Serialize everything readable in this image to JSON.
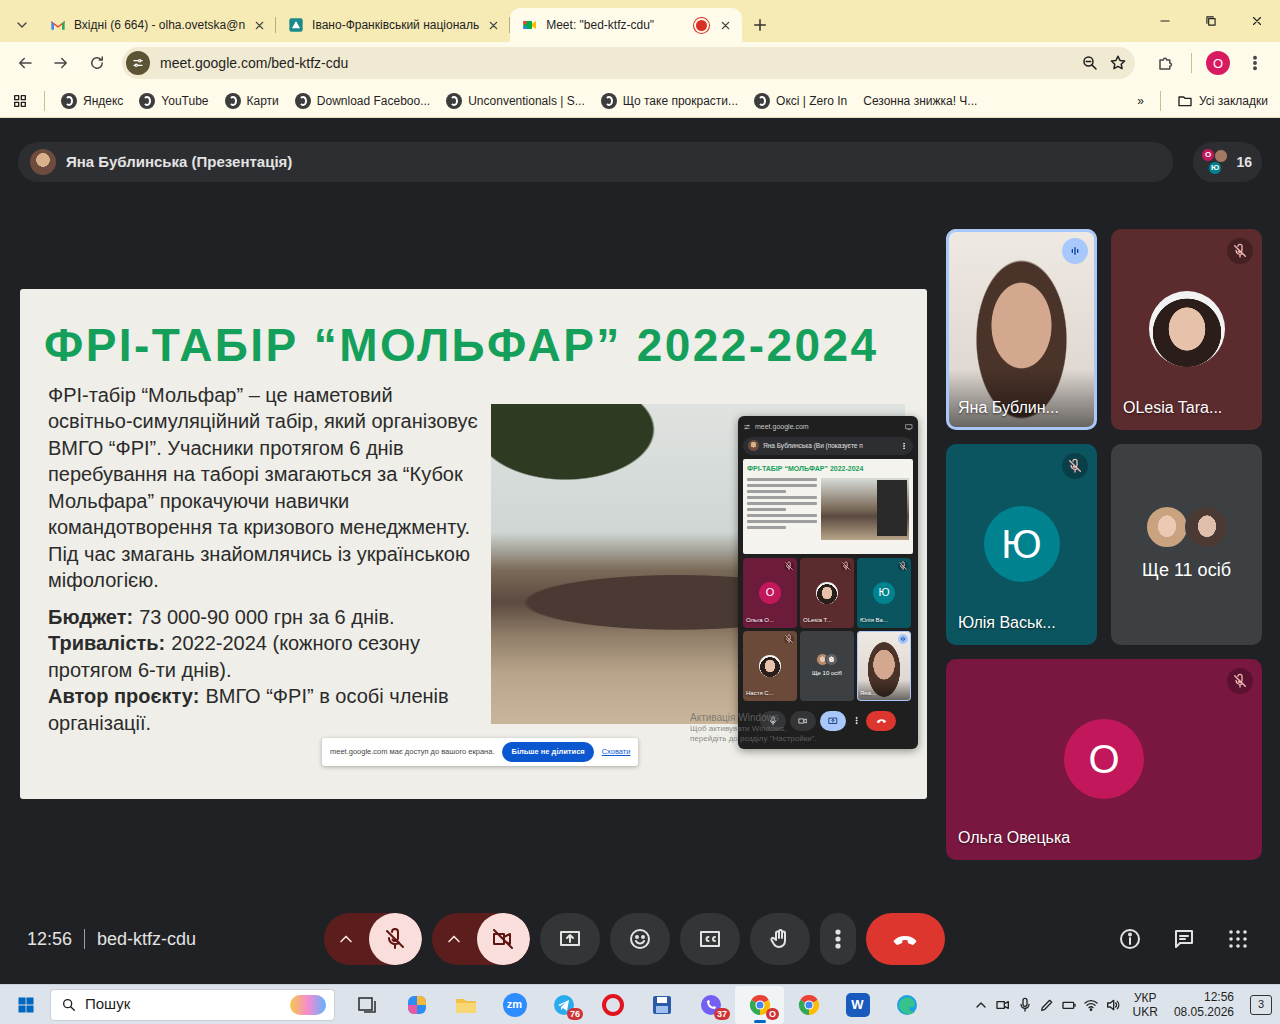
{
  "browser": {
    "tabs": [
      {
        "label": "Вхідні (6 664) - olha.ovetska@n",
        "kind": "gmail",
        "selected": false,
        "recording": false
      },
      {
        "label": "Івано-Франківський національ",
        "kind": "site",
        "selected": false,
        "recording": false
      },
      {
        "label": "Meet: \"bed-ktfz-cdu\"",
        "kind": "meet",
        "selected": true,
        "recording": true
      }
    ],
    "url": "meet.google.com/bed-ktfz-cdu",
    "profile": "O",
    "bookmarks": [
      {
        "label": "Яндекс",
        "icon": true
      },
      {
        "label": "YouTube",
        "icon": true
      },
      {
        "label": "Карти",
        "icon": true
      },
      {
        "label": "Download Faceboo...",
        "icon": true
      },
      {
        "label": "Unconventionals | S...",
        "icon": true
      },
      {
        "label": "Що таке прокрасти...",
        "icon": true
      },
      {
        "label": "Оксі | Zero In",
        "icon": true
      },
      {
        "label": "Сезонна знижка! Ч...",
        "icon": false
      }
    ],
    "bookmarks_more": "»",
    "all_bookmarks": "Усі закладки"
  },
  "meet": {
    "presenter_bar": "Яна Бублинська (Презентація)",
    "people_count": "16",
    "people_avatars": [
      {
        "initial": "О",
        "color": "#c2185b"
      },
      {
        "color": "#a47864"
      },
      {
        "initial": "Ю",
        "color": "#00838f"
      }
    ],
    "slide": {
      "title": "ФРІ-ТАБІР “МОЛЬФАР” 2022-2024",
      "intro": "ФРІ-табір “Мольфар” – це наметовий освітньо-симуляційний табір, який організовує ВМГО “ФРІ”. Учасники протягом 6 днів перебування на таборі змагаються за “Кубок Мольфара” прокачуючи навички командотворення та кризового менеджменту. Під час змагань знайомлячись із українською міфологією.",
      "facts": [
        {
          "label": "Бюджет:",
          "value": "73 000-90 000 грн за 6 днів."
        },
        {
          "label": "Тривалість:",
          "value": "2022-2024 (кожного сезону протягом 6-ти днів)."
        },
        {
          "label": "Автор проєкту:",
          "value": "ВМГО “ФРІ” в особі членів організації."
        }
      ]
    },
    "shared_preview": {
      "url": "meet.google.com",
      "presenter": "Яна Бублинська (Ви (показуєте п",
      "slide_title": "ФРІ-ТАБІР “МОЛЬФАР” 2022-2024",
      "tiles": [
        {
          "name": "Ольга О...",
          "kind": "initial",
          "initial": "О",
          "muted": true,
          "speaking": false,
          "selected": false,
          "color": "#6d1b3b",
          "avatar_color": "#c2185b"
        },
        {
          "name": "OLesia T...",
          "kind": "photo",
          "muted": true,
          "speaking": false,
          "selected": false,
          "color": "#5c2b2e"
        },
        {
          "name": "Юлія Ва...",
          "kind": "initial",
          "initial": "Ю",
          "muted": true,
          "speaking": false,
          "selected": false,
          "color": "#0b5560",
          "avatar_color": "#00838f"
        },
        {
          "name": "Настя С...",
          "kind": "photo",
          "muted": true,
          "speaking": false,
          "selected": false,
          "color": "#6b4a3a"
        },
        {
          "name": "Ще 10 осіб",
          "kind": "group",
          "muted": false,
          "speaking": false,
          "selected": false,
          "color": "#3c4043",
          "avatars": [
            {
              "color": "#b58a6e"
            },
            {
              "initial": "В",
              "color": "#5f6368"
            }
          ]
        },
        {
          "name": "Яна...",
          "kind": "video",
          "muted": false,
          "speaking": true,
          "selected": true,
          "color": "#dcd6cf"
        }
      ],
      "controls": {
        "mic_muted": false,
        "camera_off": false,
        "present_on": true
      }
    },
    "watermark": [
      "Активація Windows",
      "Щоб активувати Windows, перейдіть до розділу \"Настройки\"."
    ],
    "share_notice": {
      "text": "meet.google.com має доступ до вашого екрана.",
      "stop": "Більше не ділитися",
      "hide": "Сховати"
    },
    "tiles": [
      {
        "name": "Яна Бублин...",
        "kind": "video",
        "muted": false,
        "speaking": true,
        "selected": true,
        "color": "#dcd6cf"
      },
      {
        "name": "OLesia Tara...",
        "kind": "photo",
        "muted": true,
        "speaking": false,
        "selected": false,
        "color": "#5c2b2e"
      },
      {
        "name": "Юлія Васьк...",
        "kind": "initial",
        "initial": "Ю",
        "muted": true,
        "speaking": false,
        "selected": false,
        "color": "#0b5560",
        "avatar_color": "#00838f"
      },
      {
        "name": "Ще 11 осіб",
        "kind": "group",
        "muted": false,
        "speaking": false,
        "selected": false,
        "color": "#3c4043",
        "avatars": [
          {
            "color": "#c9a27f"
          },
          {
            "color": "#4a3a33"
          }
        ]
      },
      {
        "name": "Ольга Овецька",
        "kind": "initial",
        "initial": "О",
        "muted": true,
        "speaking": false,
        "selected": false,
        "color": "#7a1740",
        "avatar_color": "#c2185b"
      }
    ],
    "toolbar": {
      "time": "12:56",
      "code": "bed-ktfz-cdu",
      "mic_muted": true,
      "camera_off": true
    }
  },
  "taskbar": {
    "search": "Пошук",
    "apps": [
      {
        "kind": "taskview",
        "selected": false
      },
      {
        "kind": "copilot",
        "selected": false
      },
      {
        "kind": "folder",
        "selected": false
      },
      {
        "kind": "zoom",
        "label": "zm",
        "selected": false
      },
      {
        "kind": "telegram",
        "badge": "76",
        "selected": false
      },
      {
        "kind": "opera",
        "selected": false
      },
      {
        "kind": "save",
        "selected": false
      },
      {
        "kind": "viber",
        "badge": "37",
        "selected": false
      },
      {
        "kind": "chrome",
        "badge": "O",
        "selected": true
      },
      {
        "kind": "chrome",
        "selected": false
      },
      {
        "kind": "word",
        "label": "W",
        "selected": false
      },
      {
        "kind": "edge",
        "selected": false
      }
    ],
    "lang": [
      "УКР",
      "UKR"
    ],
    "time": "12:56",
    "date": "08.05.2026",
    "notifications": "3"
  }
}
